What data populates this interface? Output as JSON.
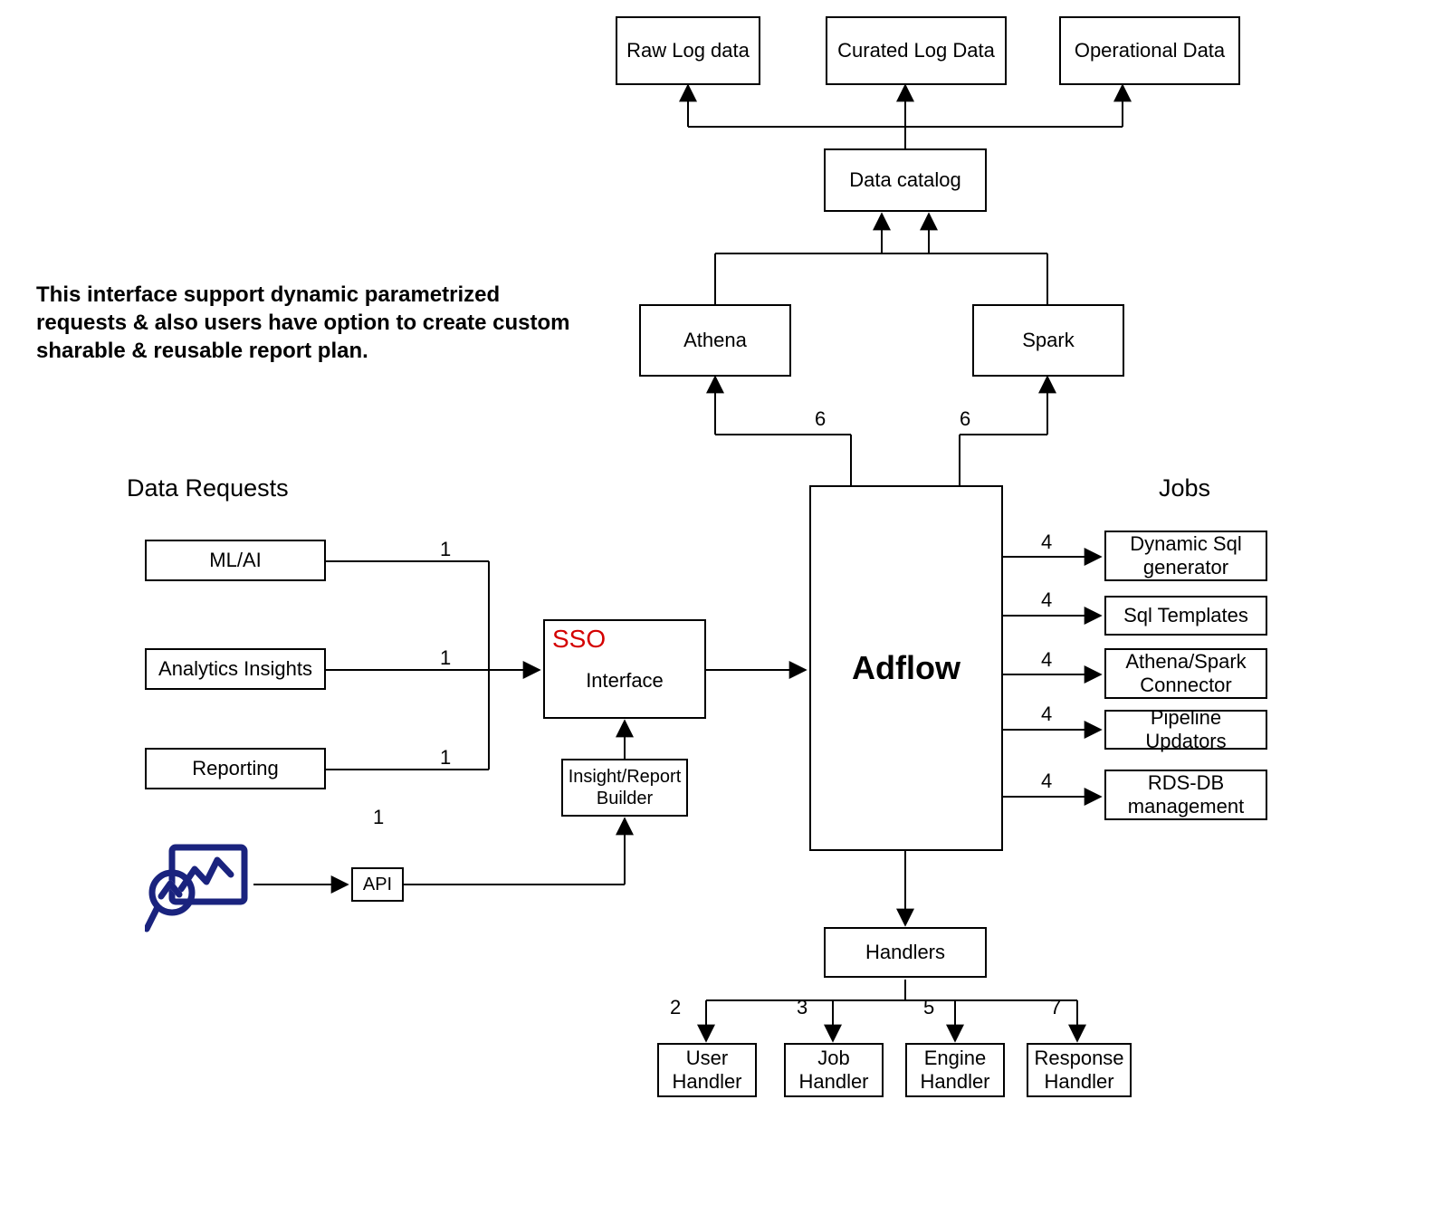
{
  "boxes": {
    "raw_log": "Raw\nLog data",
    "curated": "Curated Log Data",
    "operational": "Operational Data",
    "catalog": "Data catalog",
    "athena": "Athena",
    "spark": "Spark",
    "adflow": "Adflow",
    "interface": "Interface",
    "builder": "Insight/Report\nBuilder",
    "handlers": "Handlers",
    "user_h": "User\nHandler",
    "job_h": "Job\nHandler",
    "engine_h": "Engine\nHandler",
    "response_h": "Response\nHandler",
    "ml_ai": "ML/AI",
    "analytics": "Analytics Insights",
    "reporting": "Reporting",
    "api": "API",
    "dyn_sql": "Dynamic Sql\ngenerator",
    "sql_tpl": "Sql Templates",
    "connector": "Athena/Spark\nConnector",
    "pipeline": "Pipeline Updators",
    "rds": "RDS-DB\nmanagement"
  },
  "headings": {
    "data_requests": "Data Requests",
    "jobs": "Jobs"
  },
  "sso_label": "SSO",
  "paragraph": "This interface support dynamic parametrized requests & also users have option to create custom sharable & reusable report plan.",
  "edge_labels": {
    "one_a": "1",
    "one_b": "1",
    "one_c": "1",
    "one_d": "1",
    "two": "2",
    "three": "3",
    "five": "5",
    "seven": "7",
    "four_a": "4",
    "four_b": "4",
    "four_c": "4",
    "four_d": "4",
    "four_e": "4",
    "six_a": "6",
    "six_b": "6"
  }
}
